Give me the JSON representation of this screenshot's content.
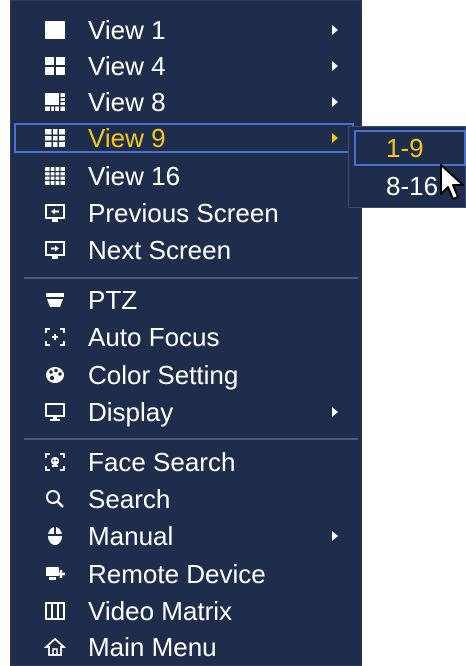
{
  "menu": {
    "items": [
      {
        "label": "View 1",
        "icon": "view-1-icon",
        "submenu": true
      },
      {
        "label": "View 4",
        "icon": "view-4-icon",
        "submenu": true
      },
      {
        "label": "View 8",
        "icon": "view-8-icon",
        "submenu": true
      },
      {
        "label": "View 9",
        "icon": "view-9-icon",
        "submenu": true,
        "highlighted": true
      },
      {
        "label": "View 16",
        "icon": "view-16-icon",
        "submenu": false
      },
      {
        "label": "Previous Screen",
        "icon": "previous-screen-icon",
        "submenu": false
      },
      {
        "label": "Next Screen",
        "icon": "next-screen-icon",
        "submenu": false
      },
      {
        "label": "PTZ",
        "icon": "ptz-icon",
        "submenu": false
      },
      {
        "label": "Auto Focus",
        "icon": "auto-focus-icon",
        "submenu": false
      },
      {
        "label": "Color Setting",
        "icon": "color-setting-icon",
        "submenu": false
      },
      {
        "label": "Display",
        "icon": "display-icon",
        "submenu": true
      },
      {
        "label": "Face Search",
        "icon": "face-search-icon",
        "submenu": false
      },
      {
        "label": "Search",
        "icon": "search-icon",
        "submenu": false
      },
      {
        "label": "Manual",
        "icon": "manual-icon",
        "submenu": true
      },
      {
        "label": "Remote Device",
        "icon": "remote-device-icon",
        "submenu": false
      },
      {
        "label": "Video Matrix",
        "icon": "video-matrix-icon",
        "submenu": false
      },
      {
        "label": "Main Menu",
        "icon": "main-menu-icon",
        "submenu": false
      }
    ]
  },
  "submenu": {
    "items": [
      {
        "label": "1-9",
        "selected": true
      },
      {
        "label": "8-16",
        "selected": false
      }
    ]
  },
  "colors": {
    "background": "#1f2d4d",
    "text": "#ffffff",
    "highlight_text": "#f5c518",
    "highlight_border": "#4a6fd0"
  }
}
